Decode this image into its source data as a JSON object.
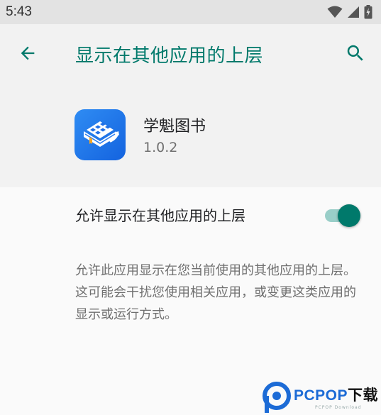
{
  "status_bar": {
    "time": "5:43",
    "icons": [
      "wifi-icon",
      "cellular-signal-icon",
      "battery-charging-icon"
    ]
  },
  "toolbar": {
    "back_icon": "arrow-back-icon",
    "title": "显示在其他应用的上层",
    "search_icon": "search-icon"
  },
  "app": {
    "name": "学魁图书",
    "version": "1.0.2",
    "icon": "book-qr-app-icon"
  },
  "setting": {
    "label": "允许显示在其他应用的上层",
    "enabled": true
  },
  "description": "允许此应用显示在您当前使用的其他应用的上层。这可能会干扰您使用相关应用，或变更这类应用的显示或运行方式。",
  "watermark": {
    "brand": "PCPOP",
    "brand_cn": "下载",
    "sub": "PCPOP Download"
  },
  "colors": {
    "accent": "#00796b",
    "toggle_track": "#99cec8",
    "header_bg": "#f2f2f2",
    "status_bg": "#e3e3e3",
    "app_icon_blue": "#1f77ea"
  }
}
